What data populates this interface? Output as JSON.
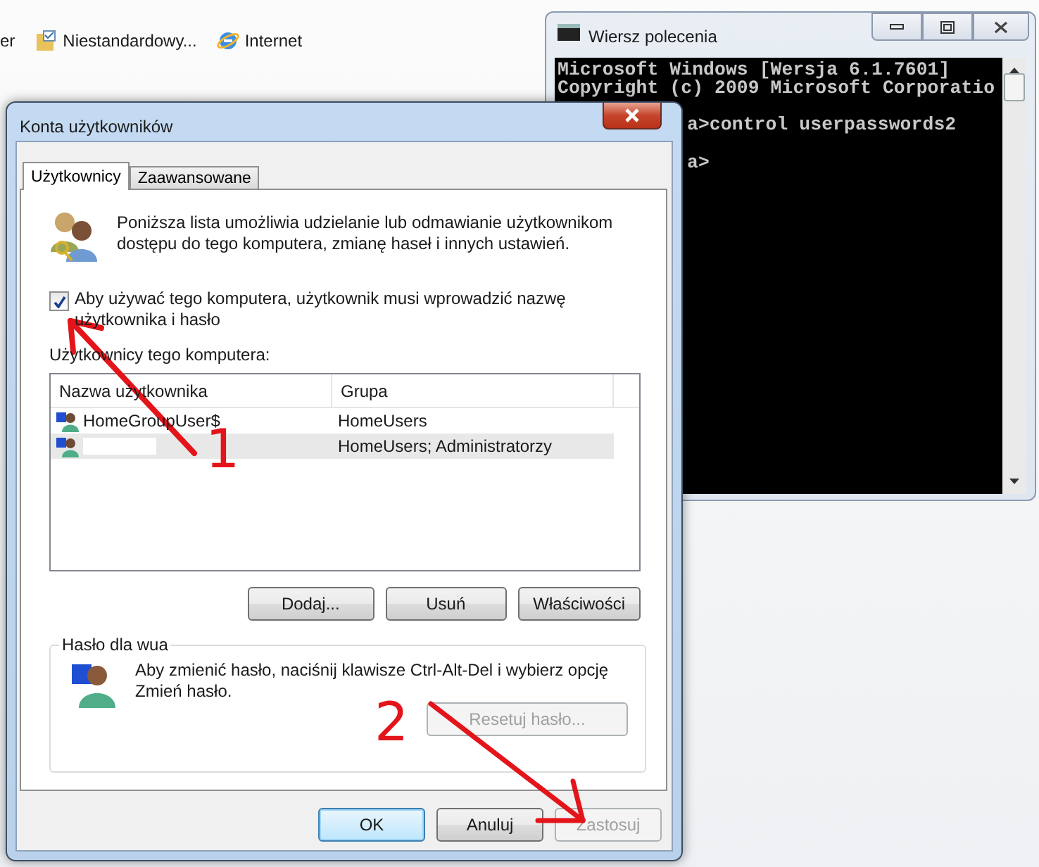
{
  "desktop_toolbar": [
    {
      "label": "er",
      "kind": "text"
    },
    {
      "label": "Niestandardowy...",
      "kind": "folder"
    },
    {
      "label": "Internet",
      "kind": "globe"
    }
  ],
  "console_window": {
    "title": "Wiersz polecenia",
    "lines": [
      {
        "text": "Microsoft Windows [Wersja 6.1.7601]",
        "kind": "plain"
      },
      {
        "text": "Copyright (c) 2009 Microsoft Corporatio",
        "kind": "plain"
      },
      {
        "text": "a>control userpasswords2",
        "kind": "prompt"
      },
      {
        "text": "a>",
        "kind": "prompt"
      }
    ]
  },
  "dialog": {
    "title": "Konta użytkowników",
    "tabs": [
      {
        "label": "Użytkownicy",
        "selected": true
      },
      {
        "label": "Zaawansowane",
        "selected": false
      }
    ],
    "intro": "Poniższa lista umożliwia udzielanie lub odmawianie użytkownikom dostępu do tego komputera, zmianę haseł i innych ustawień.",
    "require_password": {
      "label": "Aby używać tego komputera, użytkownik musi wprowadzić nazwę użytkownika i hasło",
      "checked": true
    },
    "users_caption": "Użytkownicy tego komputera:",
    "table": {
      "columns": [
        "Nazwa użytkownika",
        "Grupa"
      ],
      "rows": [
        {
          "name": "HomeGroupUser$",
          "group": "HomeUsers",
          "selected": false,
          "redacted": false
        },
        {
          "group": "HomeUsers; Administratorzy",
          "selected": true,
          "redacted": true
        }
      ]
    },
    "list_buttons": [
      {
        "label": "Dodaj...",
        "disabled": false
      },
      {
        "label": "Usuń",
        "disabled": false
      },
      {
        "label": "Właściwości",
        "disabled": false
      }
    ],
    "password_group": {
      "title": "Hasło dla wua",
      "text": "Aby zmienić hasło, naciśnij klawisze Ctrl-Alt-Del i wybierz opcję Zmień hasło.",
      "button": {
        "label": "Resetuj hasło...",
        "disabled": true
      }
    },
    "buttons": [
      {
        "label": "OK",
        "default": true,
        "disabled": false
      },
      {
        "label": "Anuluj",
        "default": false,
        "disabled": false
      },
      {
        "label": "Zastosuj",
        "default": false,
        "disabled": true
      }
    ]
  },
  "annotations": [
    {
      "label": "1"
    },
    {
      "label": "2"
    }
  ]
}
